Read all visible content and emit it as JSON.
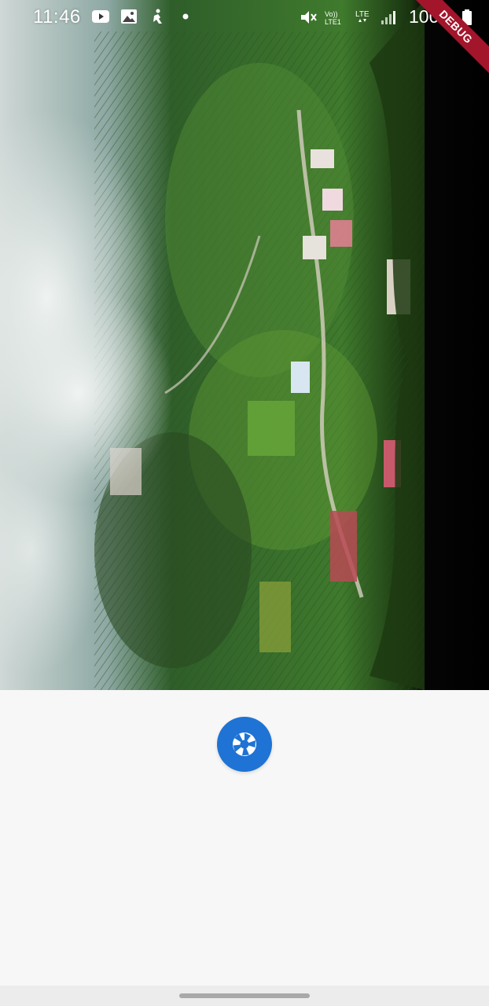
{
  "status_bar": {
    "time": "11:46",
    "battery": "100%",
    "left_icons": [
      "youtube-icon",
      "gallery-icon",
      "accessibility-icon",
      "notification-dot-icon"
    ],
    "right_icons": [
      "mute-icon",
      "volte-icon",
      "lte-icon",
      "signal-icon",
      "battery-icon"
    ]
  },
  "debug_banner": {
    "label": "DEBUG",
    "color": "#a3152b"
  },
  "camera_preview": {
    "content": "camera-preview-image"
  },
  "capture_button": {
    "icon": "camera-shutter-icon",
    "color": "#1f73d4"
  },
  "colors": {
    "background": "#f7f7f7",
    "accent": "#1f73d4"
  }
}
